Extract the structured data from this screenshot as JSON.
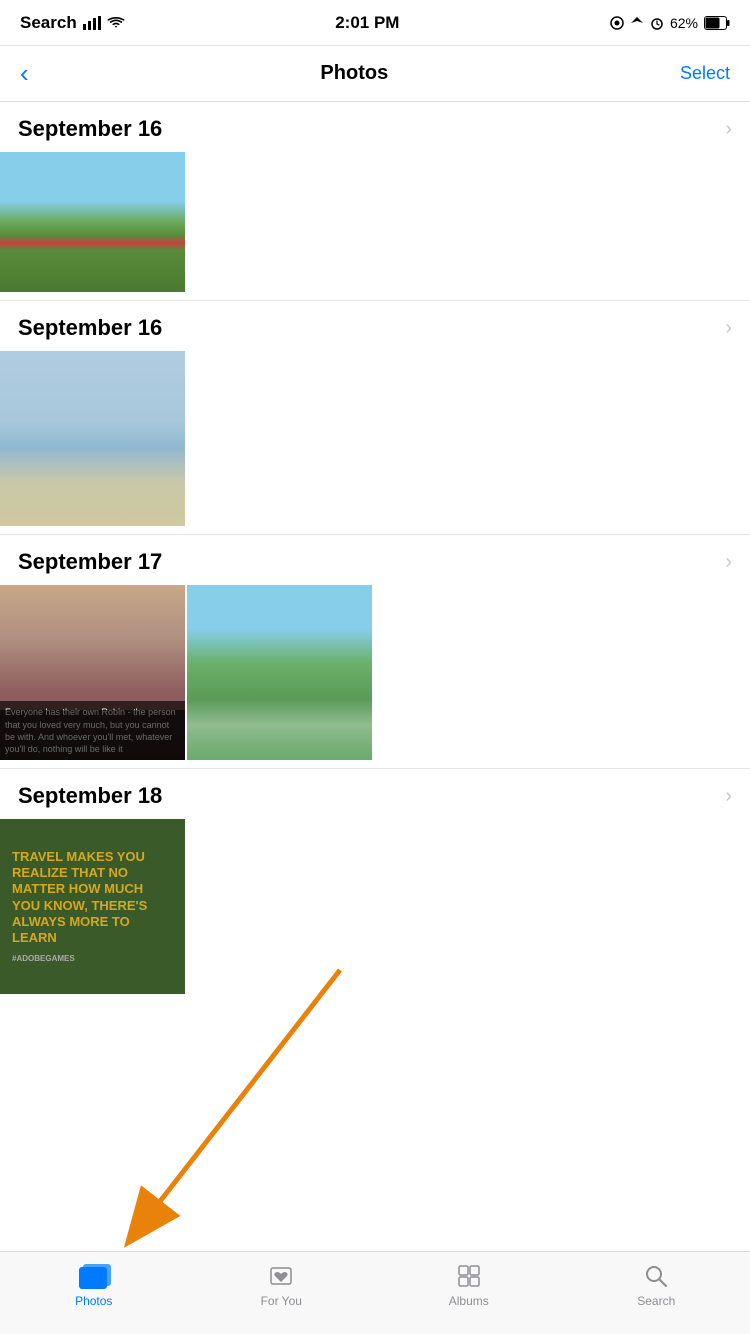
{
  "statusBar": {
    "carrier": "Search",
    "time": "2:01 PM",
    "battery": "62%"
  },
  "navBar": {
    "backLabel": "‹",
    "title": "Photos",
    "selectLabel": "Select"
  },
  "sections": [
    {
      "id": "sep16a",
      "dateLabel": "September 16",
      "photos": [
        {
          "type": "lake1",
          "description": "Lake with trees and people"
        }
      ]
    },
    {
      "id": "sep16b",
      "dateLabel": "September 16",
      "photos": [
        {
          "type": "lake2",
          "description": "Cityscape across water"
        }
      ]
    },
    {
      "id": "sep17",
      "dateLabel": "September 17",
      "photos": [
        {
          "type": "woman",
          "description": "Woman portrait with quote text",
          "quoteText": "Everyone has their own Robin - the person that you loved very much, but you cannot be with. And whoever you'll met, whatever you'll do, nothing will be like it"
        },
        {
          "type": "park",
          "description": "Park with pagoda and lake"
        }
      ]
    },
    {
      "id": "sep18",
      "dateLabel": "September 18",
      "photos": [
        {
          "type": "travel",
          "description": "Travel quote image",
          "quoteText": "TRAVEL MAKES YOU REALIZE THAT NO MATTER HOW MUCH YOU KNOW, THERE'S ALWAYS MORE TO LEARN"
        }
      ]
    }
  ],
  "tabBar": {
    "tabs": [
      {
        "id": "photos",
        "label": "Photos",
        "active": true
      },
      {
        "id": "foryou",
        "label": "For You",
        "active": false
      },
      {
        "id": "albums",
        "label": "Albums",
        "active": false
      },
      {
        "id": "search",
        "label": "Search",
        "active": false
      }
    ]
  },
  "annotation": {
    "arrowVisible": true
  }
}
